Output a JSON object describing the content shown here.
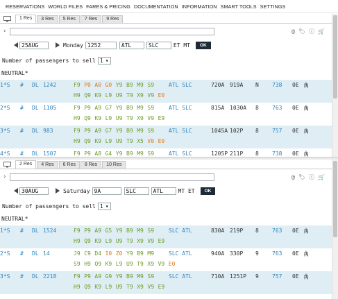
{
  "menu": [
    "RESERVATIONS",
    "WORLD FILES",
    "FARES & PRICING",
    "DOCUMENTATION",
    "INFORMATION",
    "SMART TOOLS",
    "SETTINGS"
  ],
  "panes": [
    {
      "tabs": [
        "1 Res",
        "3 Res",
        "5 Res",
        "7 Res",
        "9 Res"
      ],
      "active_tab": 0,
      "cmd_value": "",
      "date": "25AUG",
      "day": "Monday",
      "time": "1252",
      "origin": "ATL",
      "dest": "SLC",
      "tz": "ET MT",
      "ok": "OK",
      "pax_label": "Number of passengers to sell",
      "pax_value": "1",
      "neutral": "NEUTRAL*",
      "flights": [
        {
          "num": "1*S",
          "hash": "#",
          "carrier": "DL",
          "flt": "1242",
          "l1": [
            [
              "F9",
              "g"
            ],
            [
              "P0",
              "o"
            ],
            [
              "A0",
              "o"
            ],
            [
              "G0",
              "o"
            ],
            [
              "Y9",
              "g"
            ],
            [
              "B9",
              "g"
            ],
            [
              "M9",
              "g"
            ],
            [
              "S9",
              "g"
            ]
          ],
          "l2": [
            [
              "H9",
              "g"
            ],
            [
              "Q9",
              "g"
            ],
            [
              "K9",
              "g"
            ],
            [
              "L9",
              "g"
            ],
            [
              "U9",
              "g"
            ],
            [
              "T9",
              "g"
            ],
            [
              "X9",
              "g"
            ],
            [
              "V9",
              "g"
            ],
            [
              "E0",
              "o"
            ]
          ],
          "route": "ATL SLC",
          "dep": "720A",
          "arr": "919A",
          "meal": "N",
          "stops": "",
          "equip": "738",
          "elapsed": "0E",
          "hl": true
        },
        {
          "num": "2*S",
          "hash": "#",
          "carrier": "DL",
          "flt": "1105",
          "l1": [
            [
              "F9",
              "g"
            ],
            [
              "P9",
              "g"
            ],
            [
              "A9",
              "g"
            ],
            [
              "G7",
              "g"
            ],
            [
              "Y9",
              "g"
            ],
            [
              "B9",
              "g"
            ],
            [
              "M9",
              "g"
            ],
            [
              "S9",
              "g"
            ]
          ],
          "l2": [
            [
              "H9",
              "g"
            ],
            [
              "Q9",
              "g"
            ],
            [
              "K9",
              "g"
            ],
            [
              "L9",
              "g"
            ],
            [
              "U9",
              "g"
            ],
            [
              "T9",
              "g"
            ],
            [
              "X9",
              "g"
            ],
            [
              "V9",
              "g"
            ],
            [
              "E9",
              "g"
            ]
          ],
          "route": "ATL SLC",
          "dep": "815A",
          "arr": "1030A",
          "meal": "8",
          "stops": "",
          "equip": "763",
          "elapsed": "0E",
          "hl": false
        },
        {
          "num": "3*S",
          "hash": "#",
          "carrier": "DL",
          "flt": "983",
          "l1": [
            [
              "F9",
              "g"
            ],
            [
              "P9",
              "g"
            ],
            [
              "A9",
              "g"
            ],
            [
              "G7",
              "g"
            ],
            [
              "Y9",
              "g"
            ],
            [
              "B9",
              "g"
            ],
            [
              "M9",
              "g"
            ],
            [
              "S9",
              "g"
            ]
          ],
          "l2": [
            [
              "H9",
              "g"
            ],
            [
              "Q9",
              "g"
            ],
            [
              "K9",
              "g"
            ],
            [
              "L9",
              "g"
            ],
            [
              "U9",
              "g"
            ],
            [
              "T9",
              "g"
            ],
            [
              "X5",
              "g"
            ],
            [
              "V0",
              "o"
            ],
            [
              "E0",
              "o"
            ]
          ],
          "route": "ATL SLC",
          "dep": "1045A",
          "arr": "102P",
          "meal": "8",
          "stops": "",
          "equip": "757",
          "elapsed": "0E",
          "hl": true
        },
        {
          "num": "4*S",
          "hash": "#",
          "carrier": "DL",
          "flt": "1507",
          "l1": [
            [
              "F9",
              "g"
            ],
            [
              "P9",
              "g"
            ],
            [
              "A8",
              "g"
            ],
            [
              "G4",
              "g"
            ],
            [
              "Y9",
              "g"
            ],
            [
              "B9",
              "g"
            ],
            [
              "M9",
              "g"
            ],
            [
              "S9",
              "g"
            ]
          ],
          "l2": [],
          "route": "ATL SLC",
          "dep": "1205P",
          "arr": "211P",
          "meal": "8",
          "stops": "",
          "equip": "738",
          "elapsed": "0E",
          "hl": false
        }
      ]
    },
    {
      "tabs": [
        "2 Res",
        "4 Res",
        "6 Res",
        "8 Res",
        "10 Res"
      ],
      "active_tab": 0,
      "cmd_value": "",
      "date": "30AUG",
      "day": "Saturday",
      "time": "9A",
      "origin": "SLC",
      "dest": "ATL",
      "tz": "MT ET",
      "ok": "OK",
      "pax_label": "Number of passengers to sell",
      "pax_value": "1",
      "neutral": "NEUTRAL*",
      "flights": [
        {
          "num": "1*S",
          "hash": "#",
          "carrier": "DL",
          "flt": "1524",
          "l1": [
            [
              "F9",
              "g"
            ],
            [
              "P9",
              "g"
            ],
            [
              "A9",
              "g"
            ],
            [
              "G5",
              "g"
            ],
            [
              "Y9",
              "g"
            ],
            [
              "B9",
              "g"
            ],
            [
              "M9",
              "g"
            ],
            [
              "S9",
              "g"
            ]
          ],
          "l2": [
            [
              "H9",
              "g"
            ],
            [
              "Q9",
              "g"
            ],
            [
              "K9",
              "g"
            ],
            [
              "L9",
              "g"
            ],
            [
              "U9",
              "g"
            ],
            [
              "T9",
              "g"
            ],
            [
              "X9",
              "g"
            ],
            [
              "V9",
              "g"
            ],
            [
              "E9",
              "g"
            ]
          ],
          "route": "SLC ATL",
          "dep": "830A",
          "arr": "219P",
          "meal": "8",
          "stops": "",
          "equip": "763",
          "elapsed": "0E",
          "hl": true
        },
        {
          "num": "2*S",
          "hash": "#",
          "carrier": "DL",
          "flt": "14",
          "l1": [
            [
              "J9",
              "g"
            ],
            [
              "C9",
              "g"
            ],
            [
              "D4",
              "g"
            ],
            [
              "I0",
              "o"
            ],
            [
              "Z0",
              "o"
            ],
            [
              "Y9",
              "g"
            ],
            [
              "B9",
              "g"
            ],
            [
              "M9",
              "g"
            ]
          ],
          "l2": [
            [
              "S9",
              "g"
            ],
            [
              "H9",
              "g"
            ],
            [
              "Q9",
              "g"
            ],
            [
              "K9",
              "g"
            ],
            [
              "L9",
              "g"
            ],
            [
              "U9",
              "g"
            ],
            [
              "T9",
              "g"
            ],
            [
              "X9",
              "g"
            ],
            [
              "V9",
              "g"
            ],
            [
              "E0",
              "o"
            ]
          ],
          "route": "SLC ATL",
          "dep": "940A",
          "arr": "330P",
          "meal": "9",
          "stops": "",
          "equip": "763",
          "elapsed": "0E",
          "hl": false
        },
        {
          "num": "3*S",
          "hash": "#",
          "carrier": "DL",
          "flt": "2218",
          "l1": [
            [
              "F9",
              "g"
            ],
            [
              "P9",
              "g"
            ],
            [
              "A9",
              "g"
            ],
            [
              "G9",
              "g"
            ],
            [
              "Y9",
              "g"
            ],
            [
              "B9",
              "g"
            ],
            [
              "M9",
              "g"
            ],
            [
              "S9",
              "g"
            ]
          ],
          "l2": [
            [
              "H9",
              "g"
            ],
            [
              "Q9",
              "g"
            ],
            [
              "K9",
              "g"
            ],
            [
              "L9",
              "g"
            ],
            [
              "U9",
              "g"
            ],
            [
              "T9",
              "g"
            ],
            [
              "X9",
              "g"
            ],
            [
              "V9",
              "g"
            ],
            [
              "E9",
              "g"
            ]
          ],
          "route": "SLC ATL",
          "dep": "710A",
          "arr": "1251P",
          "meal": "9",
          "stops": "",
          "equip": "757",
          "elapsed": "0E",
          "hl": true
        }
      ]
    }
  ]
}
